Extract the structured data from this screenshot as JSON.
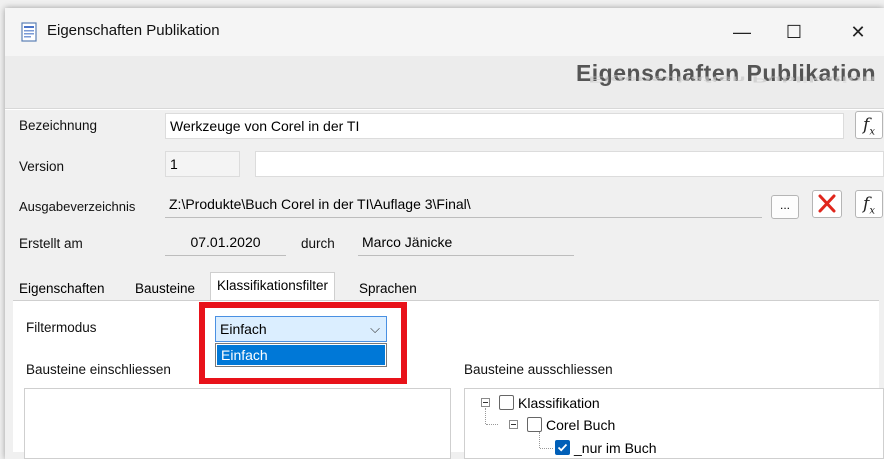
{
  "window": {
    "title": "Eigenschaften Publikation",
    "controls": {
      "minimize": "—",
      "maximize": "☐",
      "close": "✕"
    }
  },
  "header": {
    "title": "Eigenschaften  Publikation"
  },
  "form": {
    "bezeichnung": {
      "label": "Bezeichnung",
      "value": "Werkzeuge von Corel in der TI"
    },
    "version": {
      "label": "Version",
      "value": "1",
      "extra_value": ""
    },
    "ausgabeverzeichnis": {
      "label": "Ausgabeverzeichnis",
      "value": "Z:\\Produkte\\Buch Corel in der TI\\Auflage 3\\Final\\",
      "browse_label": "..."
    },
    "erstellt": {
      "label": "Erstellt am",
      "date": "07.01.2020",
      "by_label": "durch",
      "author": "Marco Jänicke"
    }
  },
  "tabs": [
    "Eigenschaften",
    "Bausteine",
    "Klassifikationsfilter",
    "Sprachen"
  ],
  "active_tab": "Klassifikationsfilter",
  "filter": {
    "label": "Filtermodus",
    "selected": "Einfach",
    "options": [
      "Einfach"
    ]
  },
  "include_list": {
    "label": "Bausteine einschliessen"
  },
  "exclude_list": {
    "label": "Bausteine ausschliessen",
    "tree": [
      {
        "label": "Klassifikation",
        "checked": false
      },
      {
        "label": "Corel Buch",
        "checked": false
      },
      {
        "label": "_nur im Buch",
        "checked": true
      }
    ]
  },
  "colors": {
    "highlight": "#e8121a",
    "selection": "#0078d7",
    "delete_icon": "#e0261c"
  },
  "icons": [
    "document-properties-icon",
    "fx-icon",
    "delete-x-icon",
    "chevron-down-icon",
    "tree-collapse-icon",
    "checkbox-icon"
  ]
}
